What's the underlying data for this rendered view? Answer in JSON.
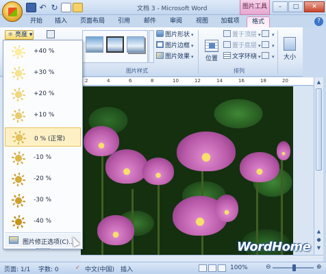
{
  "window": {
    "title": "文档 3 - Microsoft Word",
    "context_group": "图片工具",
    "controls": {
      "minimize": "–",
      "maximize": "□",
      "close": "✕"
    }
  },
  "tabs": [
    "开始",
    "插入",
    "页面布局",
    "引用",
    "邮件",
    "审阅",
    "视图",
    "加载项",
    "格式"
  ],
  "active_tab": "格式",
  "ribbon": {
    "adjust": {
      "brightness_label": "亮度"
    },
    "picture_styles": {
      "group_label": "图片样式",
      "picture_shape": "图片形状",
      "picture_border": "图片边框",
      "picture_effects": "图片效果"
    },
    "arrange": {
      "group_label": "排列",
      "bring_to_front": "置于顶层",
      "send_to_back": "置于底层",
      "text_wrapping": "文字环绕",
      "position": "位置"
    },
    "size": {
      "label": "大小"
    }
  },
  "brightness_menu": {
    "items": [
      {
        "label": "+40 %"
      },
      {
        "label": "+30 %"
      },
      {
        "label": "+20 %"
      },
      {
        "label": "+10 %"
      },
      {
        "label": "0 % (正常)"
      },
      {
        "label": "-10 %"
      },
      {
        "label": "-20 %"
      },
      {
        "label": "-30 %"
      },
      {
        "label": "-40 %"
      }
    ],
    "selected_index": 4,
    "footer": "图片修正选项(C)..."
  },
  "ruler": {
    "ticks": [
      "2",
      "4",
      "6",
      "8",
      "10",
      "12",
      "14",
      "16",
      "18",
      "20"
    ]
  },
  "watermark": "WordHome",
  "statusbar": {
    "page": "页面: 1/1",
    "words": "字数: 0",
    "language": "中文(中国)",
    "mode": "插入",
    "zoom": "100%"
  }
}
